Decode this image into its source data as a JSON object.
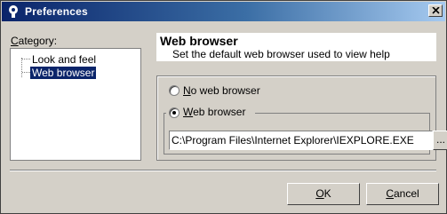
{
  "window": {
    "title": "Preferences"
  },
  "category": {
    "label_prefix": "C",
    "label_rest": "ategory:",
    "items": [
      {
        "label": "Look and feel",
        "selected": false
      },
      {
        "label": "Web browser",
        "selected": true
      }
    ]
  },
  "panel": {
    "title": "Web browser",
    "description": "Set the default web browser used to view help"
  },
  "options": {
    "no_browser": {
      "mnemonic": "N",
      "rest": "o web browser",
      "checked": false
    },
    "web_browser": {
      "mnemonic": "W",
      "rest": "eb browser",
      "checked": true
    },
    "path_value": "C:\\Program Files\\Internet Explorer\\IEXPLORE.EXE",
    "browse_label": "..."
  },
  "buttons": {
    "ok": {
      "mnemonic": "O",
      "rest": "K"
    },
    "cancel": {
      "mnemonic": "C",
      "rest": "ancel"
    }
  },
  "colors": {
    "title_bar_start": "#0a246a",
    "title_bar_end": "#a6caf0",
    "selection": "#0a246a",
    "face": "#d4d0c8"
  },
  "icons": {
    "app": "gear-hand-icon",
    "close": "close-icon"
  }
}
